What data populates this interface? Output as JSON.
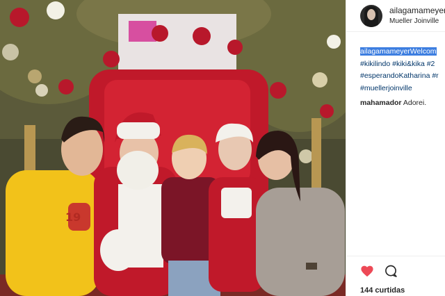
{
  "post": {
    "username": "ailagamameyer",
    "location": "Mueller Joinville",
    "caption": {
      "line1_user": "ailagamameyer",
      "line1_text": "Welcom",
      "line2": "#kikilindo #kiki&kika #2",
      "line3": "#esperandoKatharina #r",
      "line4": "#muellerjoinville"
    },
    "comment": {
      "user": "mahamador",
      "text": "Adorei."
    },
    "likes": "144 curtidas"
  },
  "icons": {
    "like": "heart-icon",
    "comment": "comment-bubble-icon"
  },
  "colors": {
    "heart": "#ed4956",
    "hashtag": "#003569",
    "selection": "#3d7ee0",
    "chair": "#c0192a",
    "shirt_yellow": "#f2c21a"
  }
}
